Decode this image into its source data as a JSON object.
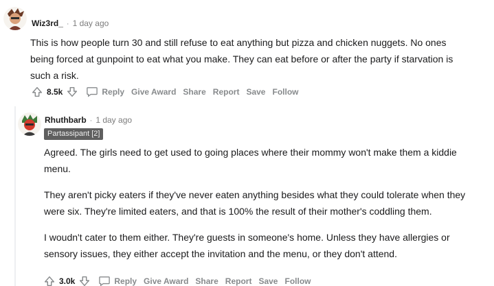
{
  "comments": [
    {
      "username": "Wiz3rd_",
      "separator": "·",
      "time": "1 day ago",
      "paragraphs": [
        "This is how people turn 30 and still refuse to eat anything but pizza and chicken nuggets. No ones being forced at gunpoint to eat what you make. They can eat before or after the party if starvation is such a risk."
      ],
      "score": "8.5k",
      "actions": {
        "reply": "Reply",
        "award": "Give Award",
        "share": "Share",
        "report": "Report",
        "save": "Save",
        "follow": "Follow"
      }
    },
    {
      "username": "Rhuthbarb",
      "separator": "·",
      "time": "1 day ago",
      "flair": "Partassipant [2]",
      "paragraphs": [
        "Agreed. The girls need to get used to going places where their mommy won't make them a kiddie menu.",
        "They aren't picky eaters if they've never eaten anything besides what they could tolerate when they were six. They're limited eaters, and that is 100% the result of their mother's coddling them.",
        "I woudn't cater to them either. They're guests in someone's home. Unless they have allergies or sensory issues, they either accept the invitation and the menu, or they don't attend."
      ],
      "score": "3.0k",
      "actions": {
        "reply": "Reply",
        "award": "Give Award",
        "share": "Share",
        "report": "Report",
        "save": "Save",
        "follow": "Follow"
      }
    }
  ],
  "colors": {
    "text": "#1a1a1b",
    "meta": "#878a8c",
    "flair_bg": "#5f5f5f"
  },
  "icons": [
    "upvote-icon",
    "downvote-icon",
    "reply-icon"
  ]
}
